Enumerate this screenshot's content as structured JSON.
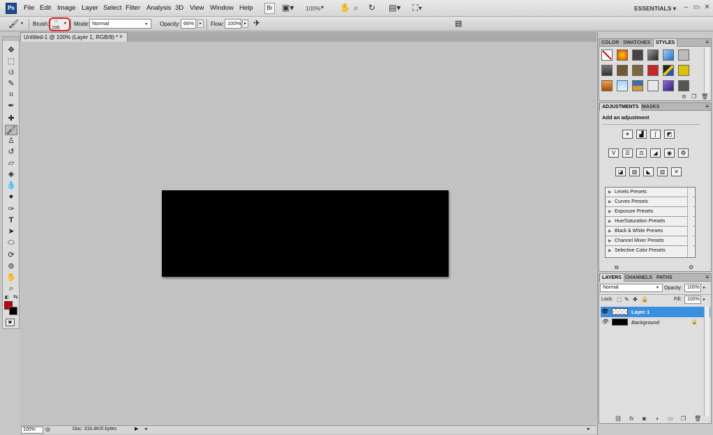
{
  "app": {
    "logo_text": "Ps"
  },
  "menu": {
    "items": [
      "File",
      "Edit",
      "Image",
      "Layer",
      "Select",
      "Filter",
      "Analysis",
      "3D",
      "View",
      "Window",
      "Help"
    ],
    "bridge_label": "Br",
    "zoom": "100%",
    "workspace": "ESSENTIALS ▾"
  },
  "options": {
    "brush_label": "Brush:",
    "brush_size": "195",
    "mode_label": "Mode:",
    "mode_value": "Normal",
    "opacity_label": "Opacity:",
    "opacity_value": "66%",
    "flow_label": "Flow:",
    "flow_value": "100%"
  },
  "document": {
    "tab_title": "Untitled-1 @ 100% (Layer 1, RGB/8) *",
    "close": "×",
    "canvas_color": "#000000"
  },
  "status": {
    "zoom": "100%",
    "doc_info": "Doc: 316.4K/0 bytes"
  },
  "styles_panel": {
    "tabs": [
      "COLOR",
      "SWATCHES",
      "STYLES"
    ],
    "active_tab": "STYLES"
  },
  "adjustments_panel": {
    "tabs": [
      "ADJUSTMENTS",
      "MASKS"
    ],
    "heading": "Add an adjustment",
    "presets": [
      "Levels Presets",
      "Curves Presets",
      "Exposure Presets",
      "Hue/Saturation Presets",
      "Black & White Presets",
      "Channel Mixer Presets",
      "Selective Color Presets"
    ]
  },
  "layers_panel": {
    "tabs": [
      "LAYERS",
      "CHANNELS",
      "PATHS"
    ],
    "blend_mode": "Normal",
    "opacity_label": "Opacity:",
    "opacity_value": "100%",
    "lock_label": "Lock:",
    "fill_label": "Fill:",
    "fill_value": "100%",
    "layers": [
      {
        "name": "Layer 1",
        "selected": true
      },
      {
        "name": "Background",
        "selected": false
      }
    ]
  },
  "colors": {
    "foreground": "#c8000b",
    "background": "#000000",
    "selection": "#3b8fe0"
  }
}
